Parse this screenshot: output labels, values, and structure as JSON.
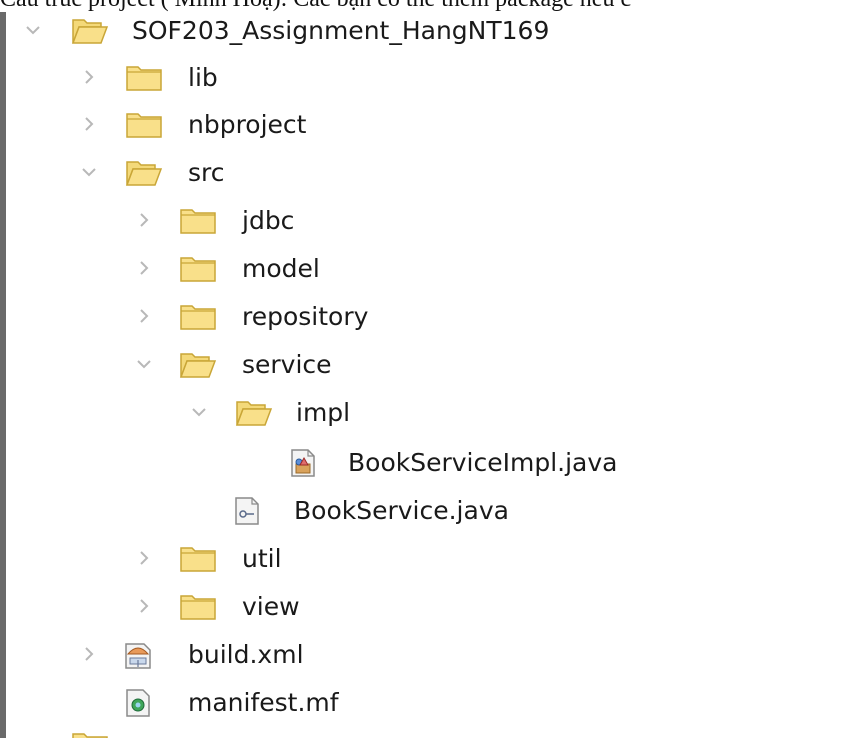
{
  "header_text": "Cấu trúc project ( Minh Hoạ): Các bạn có thể thêm package nếu c",
  "tree": {
    "root": {
      "label": "SOF203_Assignment_HangNT169",
      "icon": "folder-open-icon",
      "expanded": true
    },
    "lib": {
      "label": "lib",
      "icon": "folder-icon",
      "expanded": false
    },
    "nbproject": {
      "label": "nbproject",
      "icon": "folder-icon",
      "expanded": false
    },
    "src": {
      "label": "src",
      "icon": "folder-open-icon",
      "expanded": true
    },
    "jdbc": {
      "label": "jdbc",
      "icon": "folder-icon",
      "expanded": false
    },
    "model": {
      "label": "model",
      "icon": "folder-icon",
      "expanded": false
    },
    "repository": {
      "label": "repository",
      "icon": "folder-icon",
      "expanded": false
    },
    "service": {
      "label": "service",
      "icon": "folder-open-icon",
      "expanded": true
    },
    "impl": {
      "label": "impl",
      "icon": "folder-open-icon",
      "expanded": true
    },
    "bookserviceimpl": {
      "label": "BookServiceImpl.java",
      "icon": "java-class-file-icon"
    },
    "bookservice": {
      "label": "BookService.java",
      "icon": "java-interface-file-icon"
    },
    "util": {
      "label": "util",
      "icon": "folder-icon",
      "expanded": false
    },
    "view": {
      "label": "view",
      "icon": "folder-icon",
      "expanded": false
    },
    "buildxml": {
      "label": "build.xml",
      "icon": "ant-build-file-icon",
      "expanded": false
    },
    "manifest": {
      "label": "manifest.mf",
      "icon": "manifest-file-icon"
    }
  },
  "colors": {
    "folder_fill": "#f9e08a",
    "folder_stroke": "#c9a637",
    "chevron": "#b8b8b8",
    "text": "#1a1a1a"
  }
}
